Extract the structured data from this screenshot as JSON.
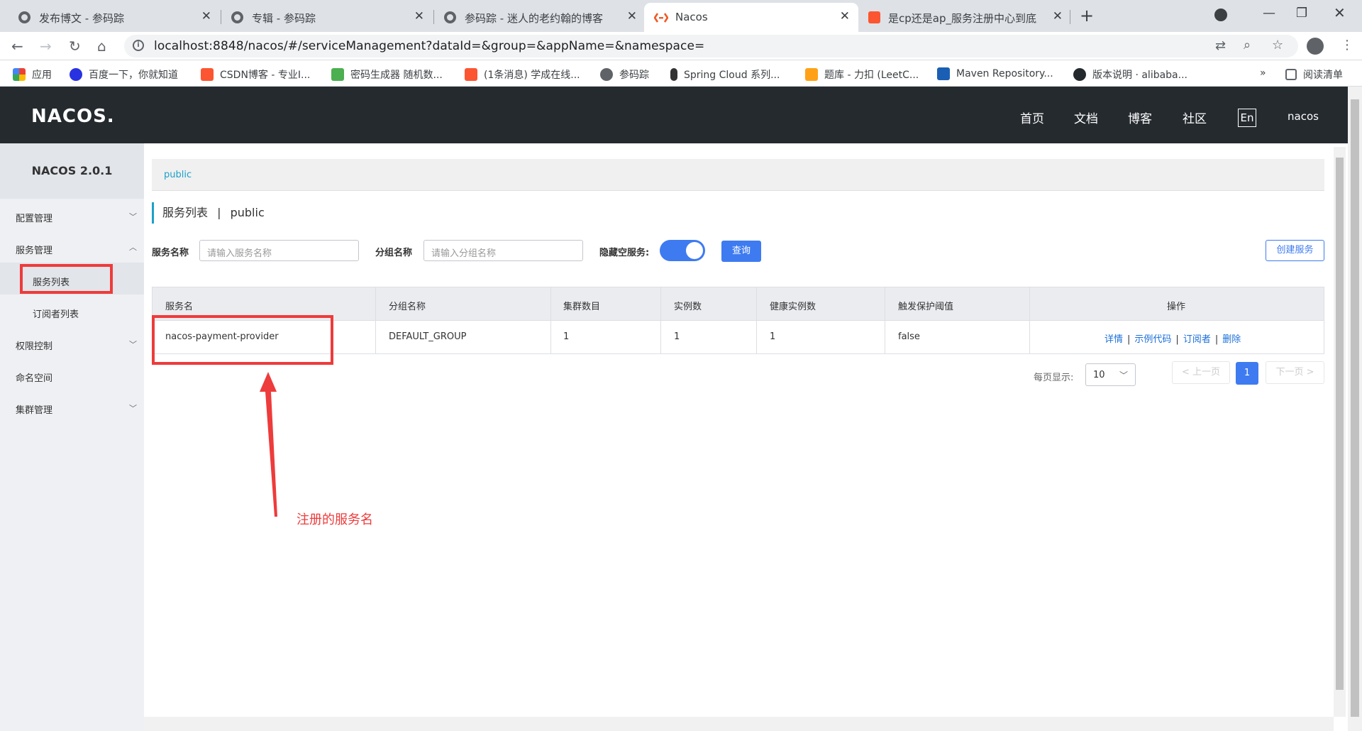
{
  "browser": {
    "tabs": [
      {
        "title": "发布博文 - 参码踪"
      },
      {
        "title": "专辑 - 参码踪"
      },
      {
        "title": "参码踪 - 迷人的老约翰的博客"
      },
      {
        "title": "Nacos"
      },
      {
        "title": "是cp还是ap_服务注册中心到底应该..."
      }
    ],
    "url": "localhost:8848/nacos/#/serviceManagement?dataId=&group=&appName=&namespace=",
    "bookmarks": [
      {
        "label": "应用"
      },
      {
        "label": "百度一下，你就知道"
      },
      {
        "label": "CSDN博客 - 专业I..."
      },
      {
        "label": "密码生成器 随机数..."
      },
      {
        "label": "(1条消息) 学成在线..."
      },
      {
        "label": "参码踪"
      },
      {
        "label": "Spring Cloud 系列..."
      },
      {
        "label": "题库 - 力扣 (LeetC..."
      },
      {
        "label": "Maven Repository..."
      },
      {
        "label": "版本说明 · alibaba..."
      }
    ],
    "more": "»",
    "reading_list": "阅读清单"
  },
  "app": {
    "logo": "NACOS.",
    "nav": [
      "首页",
      "文档",
      "博客",
      "社区"
    ],
    "lang": "En",
    "user": "nacos",
    "version": "NACOS 2.0.1"
  },
  "sidebar": {
    "config": "配置管理",
    "service": "服务管理",
    "service_list": "服务列表",
    "subscribers": "订阅者列表",
    "auth": "权限控制",
    "namespace": "命名空间",
    "cluster": "集群管理"
  },
  "main": {
    "breadcrumb": "public",
    "title_main": "服务列表",
    "title_sep": "|",
    "title_ns": "public",
    "filter": {
      "service_label": "服务名称",
      "service_placeholder": "请输入服务名称",
      "group_label": "分组名称",
      "group_placeholder": "请输入分组名称",
      "hide_empty_label": "隐藏空服务:",
      "hide_empty_on": true,
      "query_btn": "查询",
      "create_btn": "创建服务"
    },
    "table": {
      "headers": [
        "服务名",
        "分组名称",
        "集群数目",
        "实例数",
        "健康实例数",
        "触发保护阈值",
        "操作"
      ],
      "rows": [
        {
          "name": "nacos-payment-provider",
          "group": "DEFAULT_GROUP",
          "clusters": "1",
          "instances": "1",
          "healthy": "1",
          "threshold": "false"
        }
      ],
      "ops": [
        "详情",
        "示例代码",
        "订阅者",
        "删除"
      ],
      "op_sep": "|"
    },
    "pagination": {
      "per_page_label": "每页显示:",
      "per_page": "10",
      "prev": "< 上一页",
      "current": "1",
      "next": "下一页 >"
    }
  },
  "annotation": {
    "text": "注册的服务名",
    "color": "#ee3b3b"
  }
}
